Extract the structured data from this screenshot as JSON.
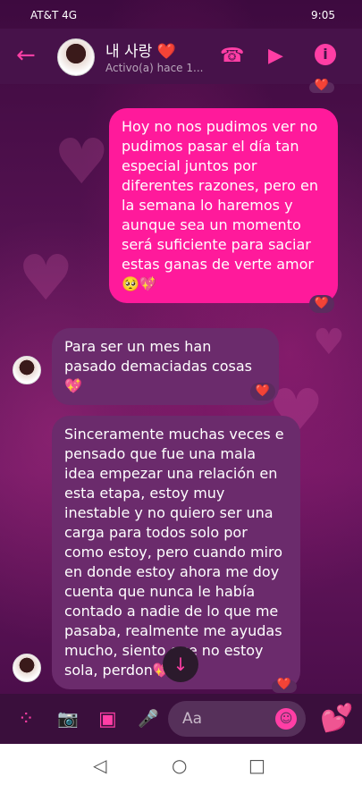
{
  "status": {
    "carrier": "AT&T 4G",
    "time": "9:05"
  },
  "header": {
    "back_icon": "←",
    "contact_name": "내 사랑 ❤️",
    "presence": "Activo(a) hace 1...",
    "call_icon": "☎",
    "video_icon": "▶",
    "info_icon": "i"
  },
  "messages": [
    {
      "direction": "out",
      "text": "Hoy no nos pudimos ver no pudimos pasar el día tan especial juntos por diferentes razones, pero en la semana lo haremos y aunque sea un momento será suficiente para saciar estas ganas de verte amor 🥺💖",
      "reaction": "❤️"
    },
    {
      "direction": "in",
      "text": "Para ser un mes han pasado demaciadas cosas 💖",
      "reaction": "❤️"
    },
    {
      "direction": "in",
      "text": "Sinceramente muchas veces e pensado que fue una mala idea empezar una relación en esta etapa, estoy muy inestable y no quiero ser una carga para todos solo por como estoy, pero cuando miro en donde estoy ahora me doy cuenta que nunca le había contado a nadie de lo que me pasaba, realmente me ayudas mucho, siento que no estoy sola, perdon💖",
      "reaction": "❤️"
    }
  ],
  "top_reaction": "❤️",
  "composer": {
    "placeholder": "Aa",
    "apps_icon": "⁘",
    "camera_icon": "📷",
    "gallery_icon": "▣",
    "mic_icon": "🎤",
    "emoji_icon": "☺",
    "quick_reaction": "💕"
  },
  "scroll_down_icon": "↓",
  "nav": {
    "back": "◁",
    "home": "○",
    "recent": "□"
  },
  "colors": {
    "accent": "#ff1a9b",
    "header": "#47124a"
  }
}
